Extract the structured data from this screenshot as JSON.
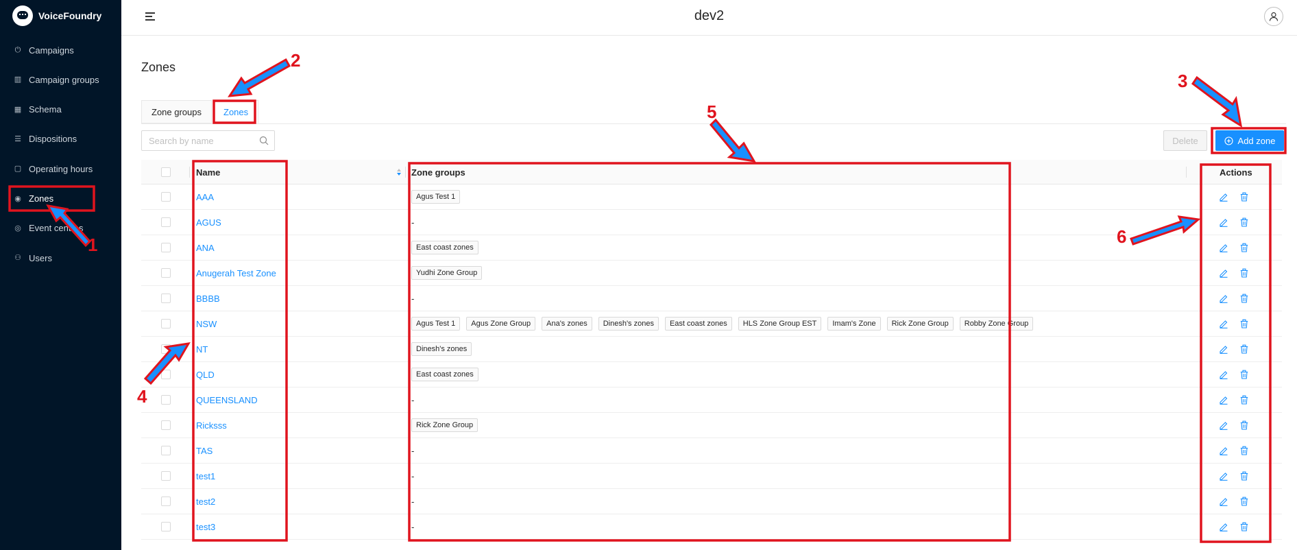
{
  "app": {
    "name": "VoiceFoundry"
  },
  "sidebar": {
    "items": [
      {
        "label": "Campaigns",
        "icon": "power-icon"
      },
      {
        "label": "Campaign groups",
        "icon": "columns-icon"
      },
      {
        "label": "Schema",
        "icon": "table-icon"
      },
      {
        "label": "Dispositions",
        "icon": "list-icon"
      },
      {
        "label": "Operating hours",
        "icon": "calendar-icon"
      },
      {
        "label": "Zones",
        "icon": "location-pin-icon",
        "active": true
      },
      {
        "label": "Event centres",
        "icon": "target-icon"
      },
      {
        "label": "Users",
        "icon": "user-icon"
      }
    ]
  },
  "header": {
    "title": "dev2"
  },
  "page": {
    "title": "Zones"
  },
  "tabs": [
    {
      "label": "Zone groups",
      "active": false
    },
    {
      "label": "Zones",
      "active": true
    }
  ],
  "search": {
    "placeholder": "Search by name",
    "value": ""
  },
  "buttons": {
    "delete": "Delete",
    "add": "Add zone"
  },
  "table": {
    "columns": {
      "name": "Name",
      "groups": "Zone groups",
      "actions": "Actions"
    },
    "rows": [
      {
        "name": "AAA",
        "groups": [
          "Agus Test 1"
        ]
      },
      {
        "name": "AGUS",
        "groups": []
      },
      {
        "name": "ANA",
        "groups": [
          "East coast zones"
        ]
      },
      {
        "name": "Anugerah Test Zone",
        "groups": [
          "Yudhi Zone Group"
        ]
      },
      {
        "name": "BBBB",
        "groups": []
      },
      {
        "name": "NSW",
        "groups": [
          "Agus Test 1",
          "Agus Zone Group",
          "Ana's zones",
          "Dinesh's zones",
          "East coast zones",
          "HLS Zone Group EST",
          "Imam's Zone",
          "Rick Zone Group",
          "Robby Zone Group"
        ]
      },
      {
        "name": "NT",
        "groups": [
          "Dinesh's zones"
        ]
      },
      {
        "name": "QLD",
        "groups": [
          "East coast zones"
        ]
      },
      {
        "name": "QUEENSLAND",
        "groups": []
      },
      {
        "name": "Ricksss",
        "groups": [
          "Rick Zone Group"
        ]
      },
      {
        "name": "TAS",
        "groups": []
      },
      {
        "name": "test1",
        "groups": []
      },
      {
        "name": "test2",
        "groups": []
      },
      {
        "name": "test3",
        "groups": []
      }
    ],
    "empty_marker": "-"
  },
  "annotations": [
    "1",
    "2",
    "3",
    "4",
    "5",
    "6"
  ],
  "colors": {
    "sidebar_bg": "#011528",
    "accent": "#1890ff",
    "annotation": "#e0141e"
  }
}
